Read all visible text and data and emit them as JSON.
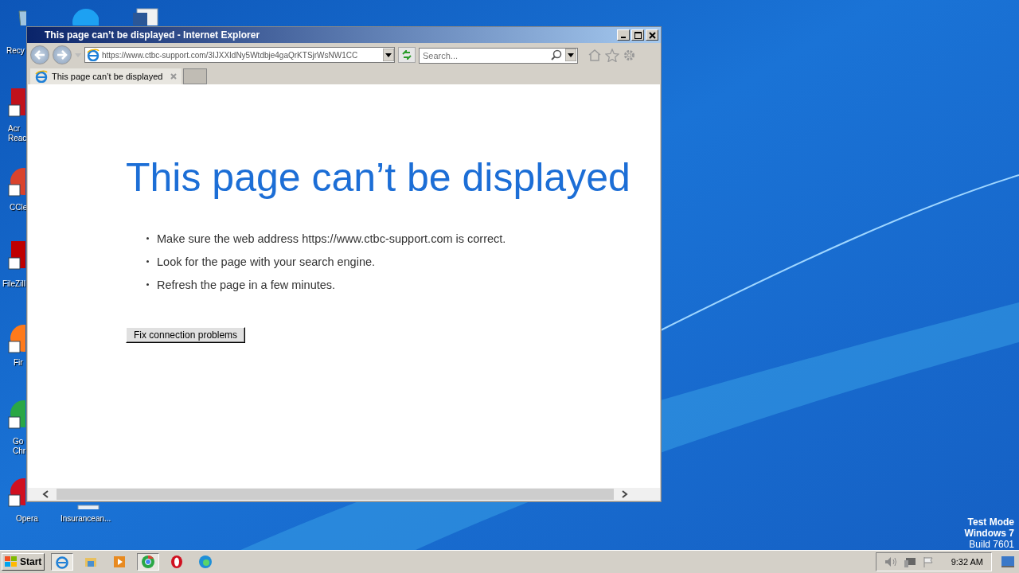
{
  "desktop_icons": [
    {
      "kind": "recycle",
      "label": "Recy"
    },
    {
      "kind": "skype"
    },
    {
      "kind": "word"
    },
    {
      "kind": "acrobat",
      "label": "Acr Reac"
    },
    {
      "kind": "ccleaner",
      "label": "CCle"
    },
    {
      "kind": "filezilla",
      "label": "FileZill"
    },
    {
      "kind": "firefox",
      "label": "Fir"
    },
    {
      "kind": "chrome",
      "label": "Go Chr"
    },
    {
      "kind": "opera",
      "label": "Opera"
    },
    {
      "kind": "file",
      "label": "Insurancean..."
    }
  ],
  "window": {
    "title": "This page can’t be displayed - Internet Explorer",
    "address": "https://www.ctbc-support.com/3IJXXIdNy5Wtdbje4gaQrKTSjrWsNW1CC",
    "search": {
      "placeholder": "Search..."
    },
    "tabs": [
      {
        "label": "This page can’t be displayed",
        "selected": true
      }
    ]
  },
  "page": {
    "heading": "This page can’t be displayed",
    "tips": [
      "Make sure the web address https://www.ctbc-support.com is correct.",
      "Look for the page with your search engine.",
      "Refresh the page in a few minutes."
    ],
    "button": "Fix connection problems"
  },
  "taskbar": {
    "start": "Start",
    "apps": [
      {
        "kind": "ie",
        "selected": true
      },
      {
        "kind": "folder",
        "selected": false
      },
      {
        "kind": "media",
        "selected": false
      },
      {
        "kind": "chrome",
        "selected": true
      },
      {
        "kind": "opera",
        "selected": false
      },
      {
        "kind": "edge",
        "selected": false
      }
    ],
    "clock": "9:32 AM"
  },
  "watermark_lines": [
    "Test Mode",
    "Windows 7",
    "Build 7601"
  ]
}
